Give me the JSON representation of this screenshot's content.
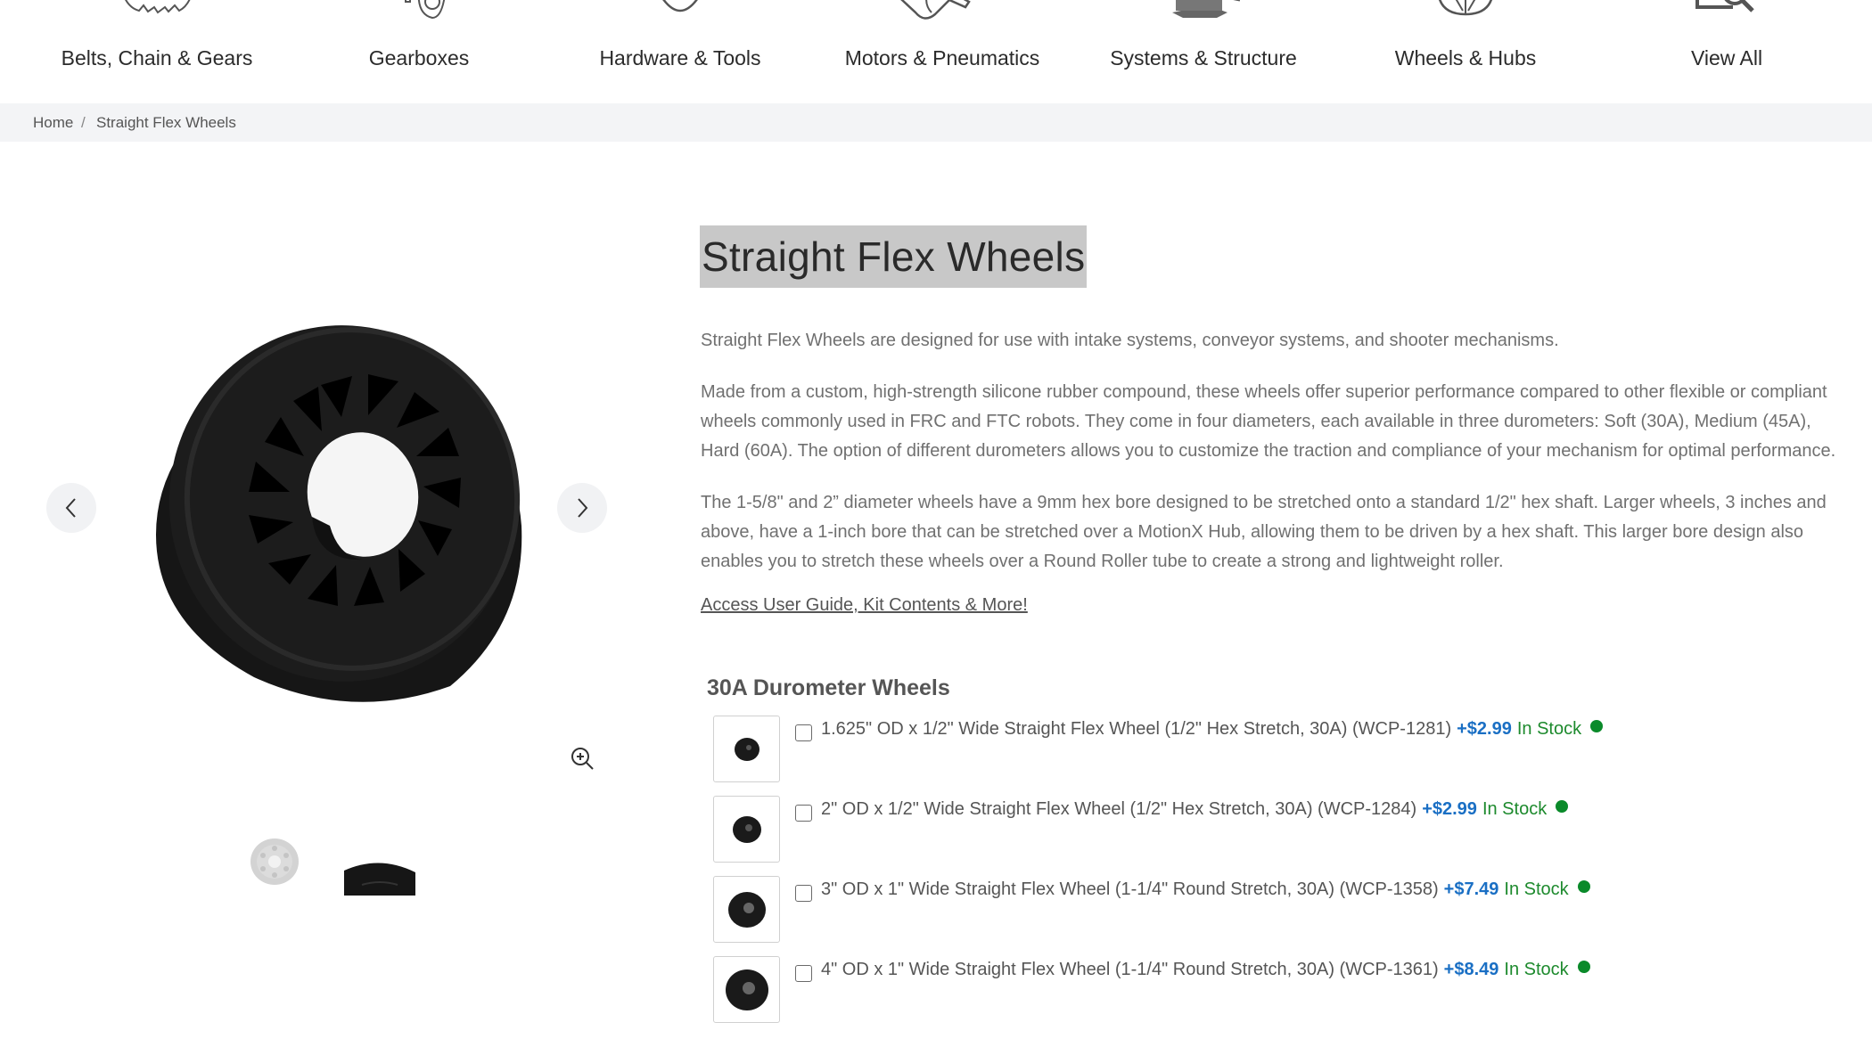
{
  "nav": {
    "categories": [
      {
        "label": "Belts, Chain & Gears",
        "icon": "gear-icon"
      },
      {
        "label": "Gearboxes",
        "icon": "gearbox-icon"
      },
      {
        "label": "Hardware & Tools",
        "icon": "hardware-icon"
      },
      {
        "label": "Motors & Pneumatics",
        "icon": "motor-icon"
      },
      {
        "label": "Systems & Structure",
        "icon": "structure-icon"
      },
      {
        "label": "Wheels & Hubs",
        "icon": "wheel-icon"
      },
      {
        "label": "View All",
        "icon": "search-icon"
      }
    ]
  },
  "breadcrumb": {
    "home": "Home",
    "separator": "/",
    "current": "Straight Flex Wheels"
  },
  "gallery": {
    "prev_icon": "chevron-left-icon",
    "next_icon": "chevron-right-icon",
    "zoom_icon": "zoom-in-icon",
    "thumbnail_count": 2
  },
  "product": {
    "title": "Straight Flex Wheels",
    "description": [
      "Straight Flex Wheels are designed for use with intake systems, conveyor systems, and shooter mechanisms.",
      "Made from a custom, high-strength silicone rubber compound, these wheels offer superior performance compared to other flexible or compliant wheels commonly used in FRC and FTC robots.  They come in four diameters, each available in three durometers: Soft (30A), Medium (45A), Hard (60A). The option of different durometers allows you to customize the traction and compliance of your mechanism for optimal performance.",
      "The 1-5/8\" and 2” diameter wheels have a 9mm hex bore designed to be stretched onto a standard 1/2\" hex shaft. Larger wheels, 3 inches and above, have a 1-inch bore that can be stretched over a MotionX Hub, allowing them to be driven by a hex shaft. This larger bore design also enables you to stretch these wheels over a Round Roller tube to create a strong and lightweight roller."
    ],
    "guide_link": "Access User Guide, Kit Contents & More!"
  },
  "options_section": {
    "heading": "30A Durometer Wheels",
    "items": [
      {
        "name": "1.625\" OD x 1/2\" Wide Straight Flex Wheel (1/2\" Hex Stretch, 30A) (WCP-1281)",
        "price": "+$2.99",
        "stock": "In Stock",
        "checked": false
      },
      {
        "name": "2\" OD x 1/2\" Wide Straight Flex Wheel (1/2\" Hex Stretch, 30A) (WCP-1284)",
        "price": "+$2.99",
        "stock": "In Stock",
        "checked": false
      },
      {
        "name": "3\" OD x 1\" Wide Straight Flex Wheel (1-1/4\" Round Stretch, 30A) (WCP-1358)",
        "price": "+$7.49",
        "stock": "In Stock",
        "checked": false
      },
      {
        "name": "4\" OD x 1\" Wide Straight Flex Wheel (1-1/4\" Round Stretch, 30A) (WCP-1361)",
        "price": "+$8.49",
        "stock": "In Stock",
        "checked": false
      }
    ]
  },
  "colors": {
    "price": "#1a6fc4",
    "in_stock": "#1d8a2d",
    "stock_dot": "#0a8a2a",
    "title_highlight": "#c8c8c8",
    "breadcrumb_bg": "#f3f4f6"
  }
}
